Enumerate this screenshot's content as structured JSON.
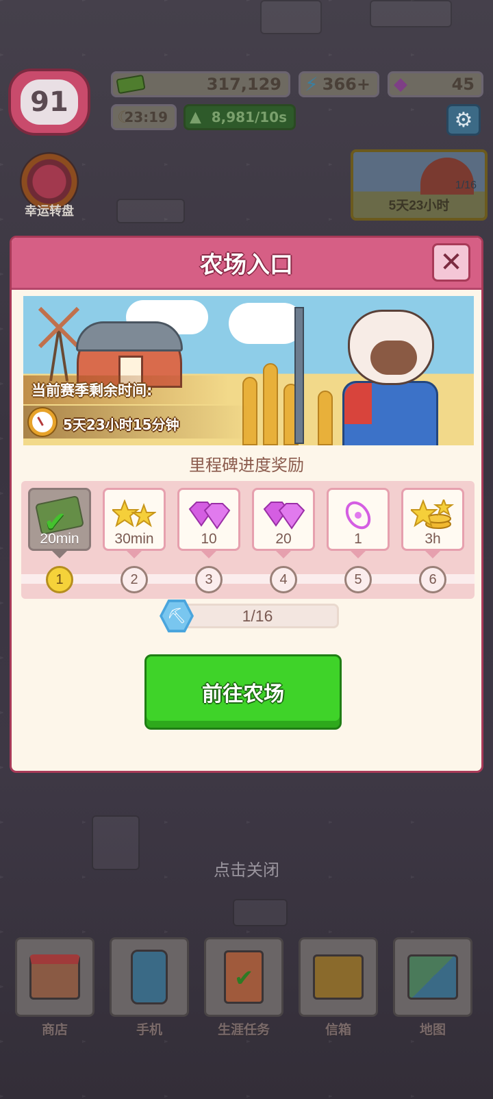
{
  "hud": {
    "level": "91",
    "cash": "317,129",
    "energy": "366+",
    "gems": "45",
    "clock": "23:19",
    "income_rate": "8,981/10s"
  },
  "lucky_wheel": {
    "label": "幸运转盘"
  },
  "farm_card": {
    "progress": "1/16",
    "time_left": "5天23小时"
  },
  "modal": {
    "title": "农场入口",
    "close_label": "✕",
    "banner": {
      "season_label": "当前赛季剩余时间:",
      "season_time": "5天23小时15分钟"
    },
    "milestone_title": "里程碑进度奖励",
    "rewards": [
      {
        "amount": "20min",
        "icon": "cash-icon",
        "claimed": true
      },
      {
        "amount": "30min",
        "icon": "stars-icon",
        "claimed": false
      },
      {
        "amount": "10",
        "icon": "gem-icon",
        "claimed": false
      },
      {
        "amount": "20",
        "icon": "gem-icon",
        "claimed": false
      },
      {
        "amount": "1",
        "icon": "ticket-icon",
        "claimed": false
      },
      {
        "amount": "3h",
        "icon": "coins-stars-icon",
        "claimed": false
      }
    ],
    "nodes": [
      "1",
      "2",
      "3",
      "4",
      "5",
      "6"
    ],
    "progress": "1/16",
    "progress_fraction": 0.0625,
    "go_button": "前往农场"
  },
  "tap_to_close": "点击关闭",
  "nav": [
    {
      "label": "商店",
      "icon": "shop-icon"
    },
    {
      "label": "手机",
      "icon": "phone-icon"
    },
    {
      "label": "生涯任务",
      "icon": "clipboard-icon"
    },
    {
      "label": "信箱",
      "icon": "mail-icon"
    },
    {
      "label": "地图",
      "icon": "map-icon"
    }
  ],
  "colors": {
    "modal_header": "#d65f85",
    "go_button": "#3fd329",
    "active_node": "#f5d23a"
  }
}
